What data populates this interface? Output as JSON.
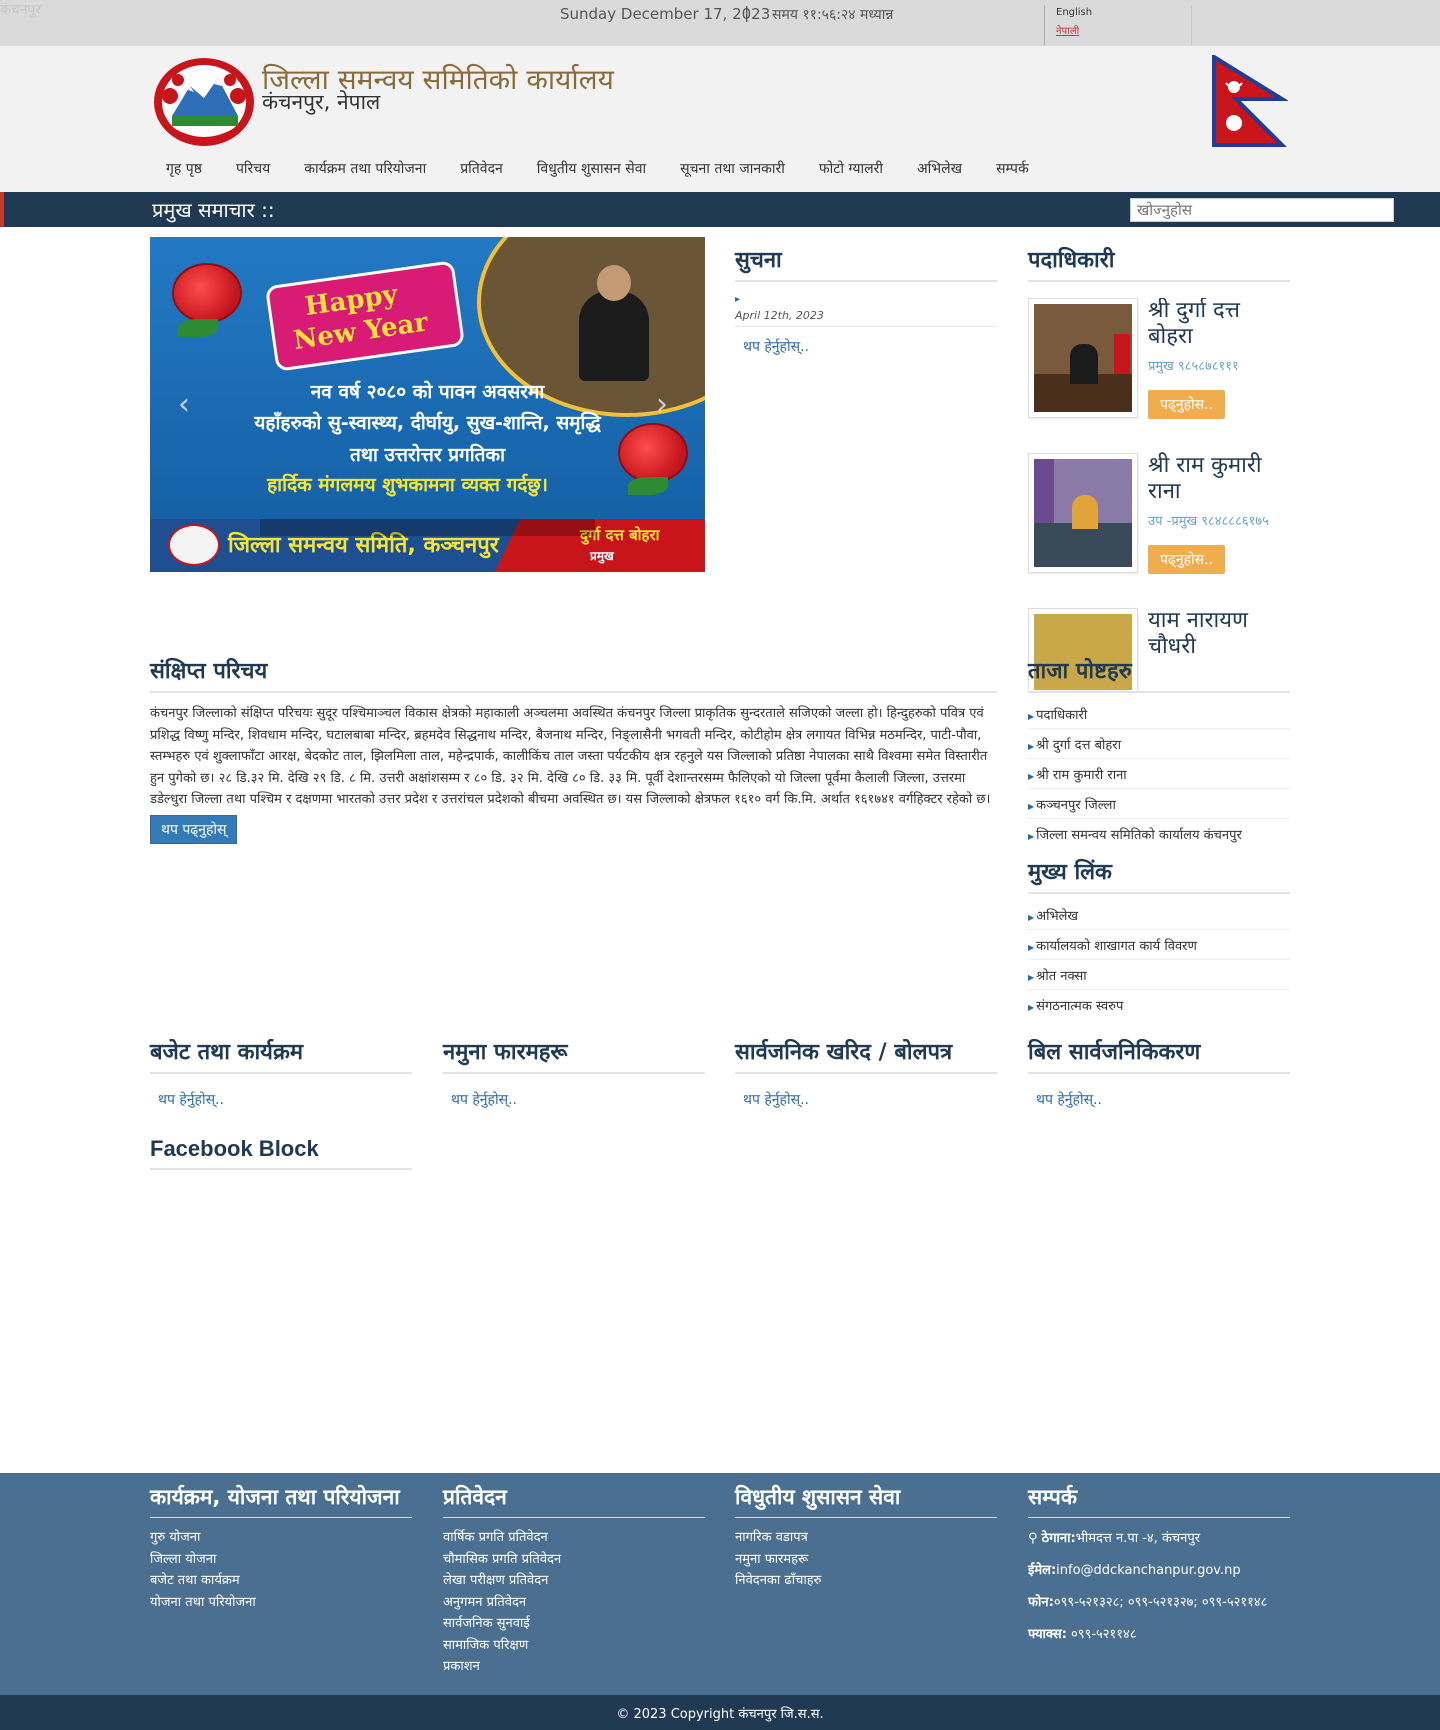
{
  "topbar": {
    "broken_image_alt": "कंचनपुर",
    "date": "Sunday December 17, 2023",
    "separator": "|",
    "time": "समय ११:५६:२४ मध्यान्न",
    "lang_en": "English",
    "lang_ne": "नेपाली"
  },
  "header": {
    "title": "जिल्ला समन्वय समितिको कार्यालय",
    "subtitle": "कंचनपुर, नेपाल"
  },
  "nav": [
    "गृह पृष्ठ",
    "परिचय",
    "कार्यक्रम तथा परियोजना",
    "प्रतिवेदन",
    "विधुतीय शुसासन सेवा",
    "सूचना तथा जानकारी",
    "फोटो ग्यालरी",
    "अभिलेख",
    "सम्पर्क"
  ],
  "newsbar": {
    "label": "प्रमुख समाचार ::",
    "search_placeholder": "खोज्नुहोस"
  },
  "slider": {
    "happy1": "Happy",
    "happy2": "New Year",
    "line1": "नव वर्ष २०८० को पावन अवसरमा",
    "line2": "यहाँहरुको सु-स्वास्थ्य, दीर्घायु, सुख-शान्ति, समृद्धि",
    "line3": "तथा उत्तरोत्तर प्रगतिका",
    "line4": "हार्दिक मंगलमय शुभकामना व्यक्त गर्दछु।",
    "org": "जिल्ला समन्वय समिति, कञ्चनपुर",
    "chief_name": "दुर्गा दत्त बोहरा",
    "chief_role": "प्रमुख",
    "prev": "‹",
    "next": "›"
  },
  "notice": {
    "heading": "सुचना",
    "bullet": "▸",
    "date": "April 12th, 2023",
    "more": "थप हेर्नुहोस्.."
  },
  "officials": {
    "heading": "पदाधिकारी",
    "items": [
      {
        "name": "श्री दुर्गा दत्त बोहरा",
        "role": "प्रमुख ९८५८७८१११",
        "button": "पढ्नुहोस.."
      },
      {
        "name": "श्री राम कुमारी राना",
        "role": "उप -प्रमुख ९८४८८८६१७५",
        "button": "पढ्नुहोस.."
      },
      {
        "name": "याम नारायण चौधरी",
        "role": "",
        "button": ""
      }
    ]
  },
  "intro": {
    "heading": "संक्षिप्त परिचय",
    "text": "कंचनपुर जिल्लाको संक्षिप्त परिचयः सुदूर पश्चिमाञ्चल विकास क्षेत्रको महाकाली अञ्चलमा अवस्थित कंचनपुर जिल्ला प्राकृतिक सुन्दरताले सजिएको जल्ला हो। हिन्दुहरुको पवित्र एवं प्रशिद्ध विष्णु मन्दिर, शिवधाम मन्दिर, घटालबाबा मन्दिर, ब्रहमदेव सिद्धनाथ मन्दिर, बैजनाथ मन्दिर, निङ्लासैनी भगवती मन्दिर, कोटीहोम क्षेत्र लगायत विभिन्न मठमन्दिर, पाटी-पौवा, स्तम्भहरु एवं शुक्लाफाँटा आरक्ष, बेदकोट ताल, झिलमिला ताल, महेन्द्रपार्क, कालीकिंच ताल जस्ता पर्यटकीय क्षत्र रहनुले यस जिल्लाको प्रतिष्ठा नेपालका साथै विश्वमा समेत विस्तारीत हुन पुगेको छ। २८ डि.३२ मि. देखि २९ डि. ८ मि. उत्तरी अक्षांशसम्म र ८० डि. ३२ मि. देखि ८० डि. ३३ मि. पूर्वी देशान्तरसम्म फैलिएको यो जिल्ला पूर्वमा कैलाली जिल्ला, उत्तरमा डडेल्धुरा जिल्ला तथा पश्चिम र दक्षणमा भारतको उत्तर प्रदेश र उत्तरांचल प्रदेशको बीचमा अवस्थित छ। यस जिल्लाको क्षेत्रफल १६१० वर्ग कि.मि. अर्थात १६१७४१ वर्गहिक्टर रहेको छ।",
    "button": "थप पढ्नुहोस्"
  },
  "latest_posts": {
    "heading": "ताजा पोष्टहरु",
    "items": [
      "पदाधिकारी",
      "श्री दुर्गा दत्त बोहरा",
      "श्री राम कुमारी राना",
      "कञ्चनपुर जिल्ला",
      "जिल्ला समन्वय समितिको कार्यालय कंचनपुर"
    ]
  },
  "main_links": {
    "heading": "मुख्य लिंक",
    "items": [
      "अभिलेख",
      "कार्यालयको शाखागत कार्य विवरण",
      "श्रोत नक्सा",
      "संगठनात्मक स्वरुप"
    ]
  },
  "bottom": [
    {
      "heading": "बजेट तथा कार्यक्रम",
      "more": "थप हेर्नुहोस्.."
    },
    {
      "heading": "नमुना फारमहरू",
      "more": "थप हेर्नुहोस्.."
    },
    {
      "heading": "सार्वजनिक खरिद / बोलपत्र",
      "more": "थप हेर्नुहोस्.."
    },
    {
      "heading": "बिल सार्वजनिकिकरण",
      "more": "थप हेर्नुहोस्.."
    }
  ],
  "facebook": {
    "heading": "Facebook Block"
  },
  "footer": {
    "col1": {
      "heading": "कार्यक्रम, योजना तथा परियोजना",
      "items": [
        "गुरु योजना",
        "जिल्ला योजना",
        "बजेट तथा कार्यक्रम",
        "योजना तथा परियोजना"
      ]
    },
    "col2": {
      "heading": "प्रतिवेदन",
      "items": [
        "वार्षिक प्रगति प्रतिवेदन",
        "चौमासिक प्रगति प्रतिवेदन",
        "लेखा परीक्षण प्रतिवेदन",
        "अनुगमन प्रतिवेदन",
        "सार्वजनिक सुनवाई",
        "सामाजिक परिक्षण",
        "प्रकाशन"
      ]
    },
    "col3": {
      "heading": "विधुतीय शुसासन सेवा",
      "items": [
        "नागरिक वडापत्र",
        "नमुना फारमहरू",
        "निवेदनका ढाँचाहरु"
      ]
    },
    "contact": {
      "heading": "सम्पर्क",
      "address_label": "ठेगाना:",
      "address": "भीमदत्त न.पा -४, कंचनपुर",
      "email_label": "ईमेल:",
      "email": "info@ddckanchanpur.gov.np",
      "phone_label": "फोन:",
      "phone": "०९९-५२१३२८; ०९९-५२१३२७; ०९९-५२११४८",
      "fax_label": "फ्याक्स:",
      "fax": "०९९-५२११४८"
    },
    "copyright": "© 2023 Copyright कंचनपुर जि.स.स."
  },
  "colors": {
    "dark_navy": "#213a54",
    "footer_blue": "#4a6f90",
    "title_brown": "#8b6b3d",
    "link_blue": "#2b6aa6",
    "orange_button": "#f0ad4e"
  }
}
